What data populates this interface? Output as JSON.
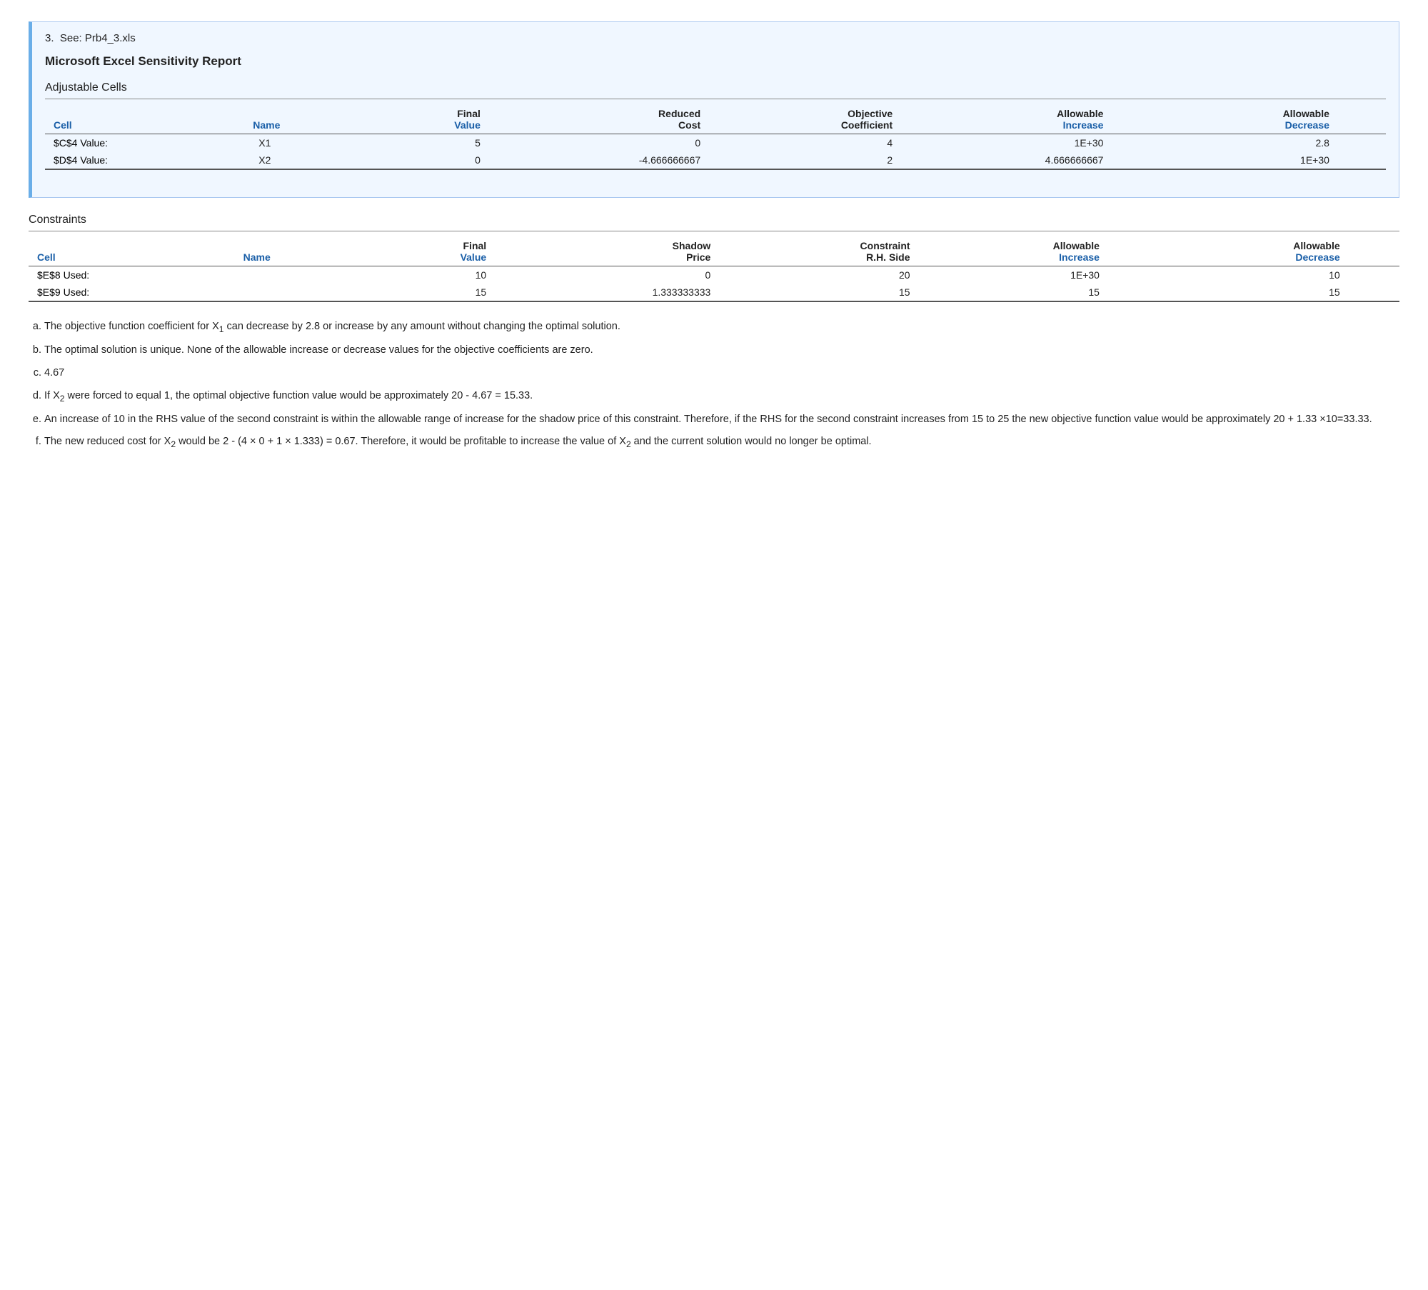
{
  "problem": {
    "number": "3.",
    "see_label": "See: Prb4_3.xls"
  },
  "report": {
    "title": "Microsoft Excel Sensitivity Report"
  },
  "adjustable_cells": {
    "section_title": "Adjustable Cells",
    "headers": {
      "row1": [
        "",
        "",
        "Final",
        "Reduced",
        "Objective",
        "Allowable",
        "",
        "Allowable",
        ""
      ],
      "row2": [
        "Cell",
        "Name",
        "Value",
        "Cost",
        "Coefficient",
        "Increase",
        "",
        "Decrease",
        ""
      ]
    },
    "rows": [
      {
        "cell": "$C$4",
        "name": "Value:",
        "name2": "X1",
        "final_value": "5",
        "reduced_cost": "0",
        "obj_coefficient": "4",
        "allowable_increase": "1E+30",
        "allowable_decrease": "2.8"
      },
      {
        "cell": "$D$4",
        "name": "Value:",
        "name2": "X2",
        "final_value": "0",
        "reduced_cost": "-4.666666667",
        "obj_coefficient": "2",
        "allowable_increase": "4.666666667",
        "allowable_decrease": "1E+30"
      }
    ]
  },
  "constraints": {
    "section_title": "Constraints",
    "headers": {
      "row1": [
        "",
        "",
        "Final",
        "Shadow",
        "Constraint",
        "Allowable",
        "",
        "Allowable",
        ""
      ],
      "row2": [
        "Cell",
        "Name",
        "Value",
        "Price",
        "R.H. Side",
        "Increase",
        "",
        "Decrease",
        ""
      ]
    },
    "rows": [
      {
        "cell": "$E$8",
        "name": "Used:",
        "final_value": "10",
        "shadow_price": "0",
        "rh_side": "20",
        "allowable_increase": "1E+30",
        "allowable_decrease": "10"
      },
      {
        "cell": "$E$9",
        "name": "Used:",
        "final_value": "15",
        "shadow_price": "1.333333333",
        "rh_side": "15",
        "allowable_increase": "15",
        "allowable_decrease": "15"
      }
    ]
  },
  "answers": {
    "items": [
      {
        "label": "a.",
        "text": "The objective function coefficient for X₁ can decrease by 2.8 or increase by any amount without changing the optimal solution."
      },
      {
        "label": "b.",
        "text": "The optimal solution is unique. None of the allowable increase or decrease values for the objective coefficients are zero."
      },
      {
        "label": "c.",
        "text": "4.67"
      },
      {
        "label": "d.",
        "text": "If X₂ were forced to equal 1, the optimal objective function value would be approximately 20 - 4.67 = 15.33."
      },
      {
        "label": "e.",
        "text": "An increase of 10 in the RHS value of the second constraint is within the allowable range of increase for the shadow price of this constraint.  Therefore, if the RHS for the second constraint increases from 15 to 25 the new objective function value would be approximately 20 + 1.33 ×10=33.33."
      },
      {
        "label": "f.",
        "text": "The new reduced cost for X₂ would be  2 - (4 × 0 + 1 × 1.333) = 0.67.  Therefore, it would be profitable to increase the value of  X₂ and the current solution would no longer be optimal."
      }
    ]
  }
}
